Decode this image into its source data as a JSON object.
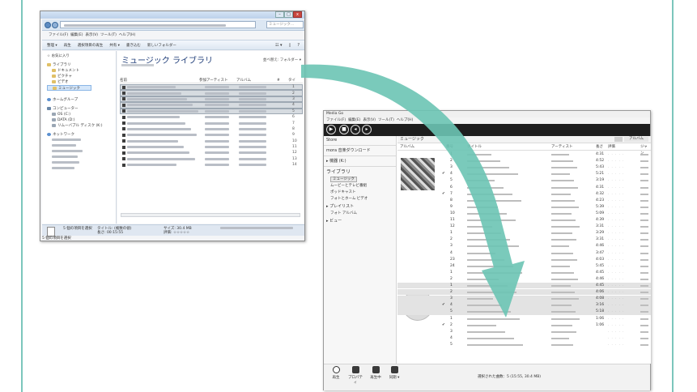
{
  "explorer": {
    "search_placeholder": "ミュージック...",
    "menu": [
      "ファイル(F)",
      "編集(E)",
      "表示(V)",
      "ツール(T)",
      "ヘルプ(H)"
    ],
    "toolbar": [
      "整理 ▾",
      "再生",
      "選択項目の再生",
      "共有 ▾",
      "書き込む",
      "新しいフォルダー"
    ],
    "nav": {
      "favorites": "お気に入り",
      "libraries": "ライブラリ",
      "documents": "ドキュメント",
      "pictures": "ピクチャ",
      "videos": "ビデオ",
      "music": "ミュージック",
      "homegroup": "ホームグループ",
      "computer": "コンピューター",
      "drive_c": "OS (C:)",
      "drive_d": "DATA (D:)",
      "drive_k": "リムーバブル ディスク (K:)",
      "network": "ネットワーク"
    },
    "library_title": "ミュージック ライブラリ",
    "arrange_by": "並べ替え: フォルダー ▾",
    "columns": [
      "名前",
      "参加アーティスト",
      "アルバム",
      "#",
      "タイ"
    ],
    "track_numbers": [
      "1",
      "2",
      "3",
      "4",
      "5",
      "6",
      "7",
      "8",
      "9",
      "10",
      "11",
      "12",
      "13",
      "14"
    ],
    "status_selected": "5 個の項目を選択",
    "status_title": "タイトル: (複数の値)",
    "status_length": "長さ: 00:15:55",
    "status_size": "サイズ: 30.4 MB",
    "status_rating": "評価: ☆☆☆☆☆",
    "bottom_status": "5 個の項目を選択"
  },
  "mediago": {
    "title": "Media Go",
    "menu": [
      "ファイル(F)",
      "編集(E)",
      "表示(V)",
      "ツール(T)",
      "ヘルプ(H)"
    ],
    "left": {
      "store": "Store",
      "mora": "mora 音楽ダウンロード",
      "device": "▸ 機器 (K:)",
      "library": "ライブラリ",
      "music": "ミュージック",
      "movies_tv": "ムービーとテレビ番組",
      "podcasts": "ポッドキャスト",
      "photo_video": "フォトとホーム ビデオ",
      "playlists": "▸ プレイリスト",
      "photo_albums": "フォト アルバム",
      "views": "▸ ビュー"
    },
    "header": "ミュージック",
    "view_label": "アルバム",
    "columns": {
      "album": "アルバム",
      "num": "番号",
      "title": "タイトル",
      "artist": "アーティスト",
      "length": "長さ",
      "rating": "評価",
      "genre": "ジャン"
    },
    "track_nums": [
      "1",
      "2",
      "3",
      "4",
      "5",
      "6",
      "7",
      "8",
      "9",
      "10",
      "11",
      "12",
      "1",
      "2",
      "3",
      "4",
      "23",
      "24",
      "1",
      "2",
      "1",
      "2",
      "3",
      "4",
      "5",
      "1",
      "2",
      "3",
      "4",
      "5"
    ],
    "lengths": [
      "4:31",
      "4:52",
      "5:43",
      "5:21",
      "3:19",
      "4:31",
      "4:32",
      "4:23",
      "5:39",
      "5:09",
      "4:39",
      "3:31",
      "3:29",
      "3:31",
      "4:46",
      "3:47",
      "4:03",
      "5:45",
      "4:45",
      "4:46",
      "4:45",
      "4:06",
      "4:08",
      "3:16",
      "5:18",
      "1:06",
      "1:06"
    ],
    "stars": "· · · · ·",
    "bottom": {
      "play": "再生",
      "properties": "プロパティ",
      "now_playing": "再生中",
      "sync": "同期 ▾"
    },
    "status": "選択された曲数：5 (15:55, 30.4 MB)"
  }
}
